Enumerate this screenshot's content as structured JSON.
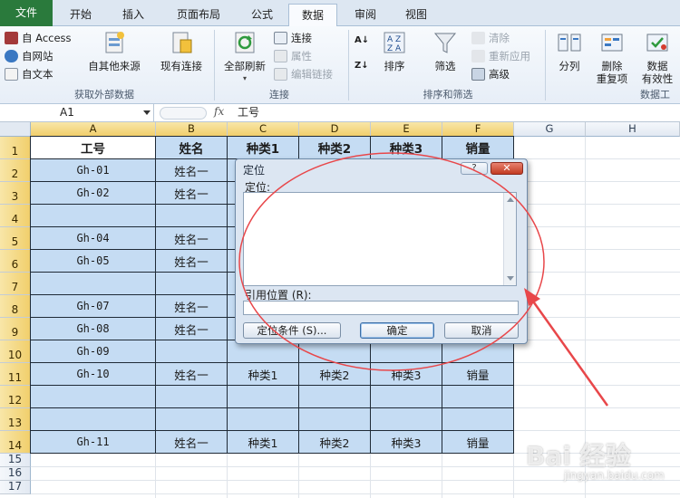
{
  "tabs": [
    {
      "id": "file",
      "label": "文件"
    },
    {
      "id": "home",
      "label": "开始"
    },
    {
      "id": "insert",
      "label": "插入"
    },
    {
      "id": "layout",
      "label": "页面布局"
    },
    {
      "id": "formulas",
      "label": "公式"
    },
    {
      "id": "data",
      "label": "数据"
    },
    {
      "id": "review",
      "label": "审阅"
    },
    {
      "id": "view",
      "label": "视图"
    }
  ],
  "ribbon": {
    "get_external": {
      "access": "自 Access",
      "web": "自网站",
      "text": "自文本",
      "other_sources": "自其他来源",
      "existing": "现有连接",
      "group_label": "获取外部数据"
    },
    "connections": {
      "refresh_all": "全部刷新",
      "connections": "连接",
      "properties": "属性",
      "edit_links": "编辑链接",
      "group_label": "连接"
    },
    "sort_filter": {
      "sort": "排序",
      "filter": "筛选",
      "clear": "清除",
      "reapply": "重新应用",
      "advanced": "高级",
      "group_label": "排序和筛选"
    },
    "data_tools": {
      "split": "分列",
      "remove_dup_1": "删除",
      "remove_dup_2": "重复项",
      "validation_1": "数据",
      "validation_2": "有效性",
      "group_label": "数据工"
    }
  },
  "formula_bar": {
    "name_box": "A1",
    "fx": "fx",
    "content": "工号"
  },
  "columns": [
    "A",
    "B",
    "C",
    "D",
    "E",
    "F",
    "G",
    "H"
  ],
  "rows": [
    "1",
    "2",
    "3",
    "4",
    "5",
    "6",
    "7",
    "8",
    "9",
    "10",
    "11",
    "12",
    "13",
    "14",
    "15",
    "16",
    "17"
  ],
  "cells": [
    [
      "工号",
      "姓名",
      "种类1",
      "种类2",
      "种类3",
      "销量"
    ],
    [
      "Gh-01",
      "姓名一",
      "",
      "",
      "",
      ""
    ],
    [
      "Gh-02",
      "姓名一",
      "",
      "",
      "",
      ""
    ],
    [
      "",
      "",
      "",
      "",
      "",
      ""
    ],
    [
      "Gh-04",
      "姓名一",
      "",
      "",
      "",
      ""
    ],
    [
      "Gh-05",
      "姓名一",
      "",
      "",
      "",
      ""
    ],
    [
      "",
      "",
      "",
      "",
      "",
      ""
    ],
    [
      "Gh-07",
      "姓名一",
      "",
      "",
      "",
      ""
    ],
    [
      "Gh-08",
      "姓名一",
      "",
      "",
      "",
      ""
    ],
    [
      "Gh-09",
      "",
      "",
      "",
      "",
      ""
    ],
    [
      "Gh-10",
      "姓名一",
      "种类1",
      "种类2",
      "种类3",
      "销量"
    ],
    [
      "",
      "",
      "",
      "",
      "",
      ""
    ],
    [
      "",
      "",
      "",
      "",
      "",
      ""
    ],
    [
      "Gh-11",
      "姓名一",
      "种类1",
      "种类2",
      "种类3",
      "销量"
    ]
  ],
  "dialog": {
    "title": "定位",
    "help": "?",
    "close": "✕",
    "goto_label": "定位:",
    "ref_label": "引用位置 (R):",
    "special_btn": "定位条件 (S)...",
    "ok_btn": "确定",
    "cancel_btn": "取消"
  },
  "watermark": {
    "logo": "Bai 经验",
    "url": "jingyan.baidu.com"
  },
  "colors": {
    "file_tab": "#2a7a3c",
    "cell_fill": "#c5dcf3",
    "annotation": "#e8474a"
  }
}
